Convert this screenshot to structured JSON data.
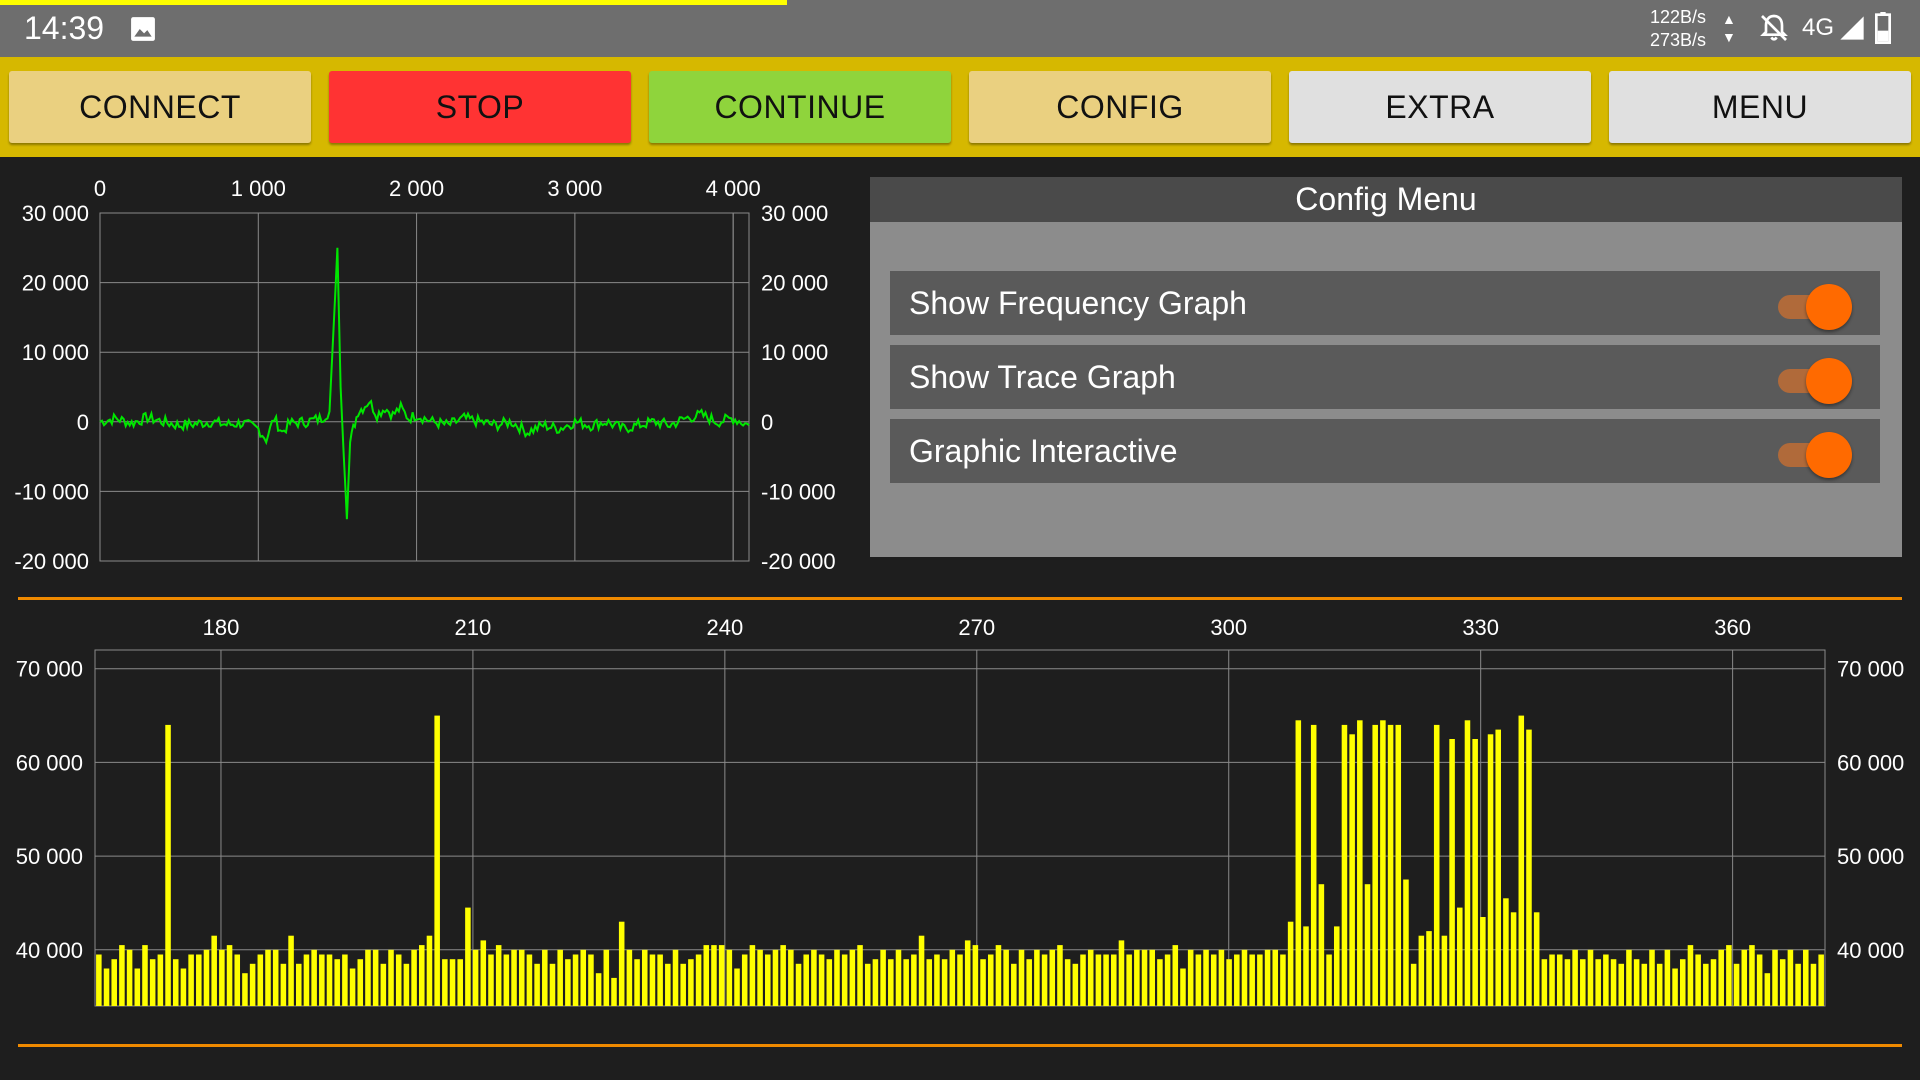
{
  "status_bar": {
    "time": "14:39",
    "net_up": "122B/s",
    "net_down": "273B/s",
    "net_type": "4G",
    "progress": 0.41,
    "icons": [
      "image-icon",
      "arrows-updown-icon",
      "bell-off-icon",
      "signal-icon",
      "battery-icon"
    ]
  },
  "toolbar": {
    "buttons": [
      {
        "label": "CONNECT",
        "color": "#ead080"
      },
      {
        "label": "STOP",
        "color": "#ff3333"
      },
      {
        "label": "CONTINUE",
        "color": "#8fd43c"
      },
      {
        "label": "CONFIG",
        "color": "#ead080"
      },
      {
        "label": "EXTRA",
        "color": "#e0e0e0"
      },
      {
        "label": "MENU",
        "color": "#e0e0e0"
      }
    ]
  },
  "config_menu": {
    "title": "Config Menu",
    "items": [
      {
        "label": "Show Frequency Graph",
        "on": true
      },
      {
        "label": "Show Trace Graph",
        "on": true
      },
      {
        "label": "Graphic Interactive",
        "on": true
      }
    ]
  },
  "colors": {
    "trace": "#00e600",
    "bars": "#ffff00",
    "separator": "#f08a00",
    "toolbar": "#d6b800"
  },
  "chart_data": [
    {
      "type": "line",
      "series": [
        {
          "color": "#00e600",
          "x": [
            0,
            100,
            200,
            300,
            400,
            500,
            600,
            700,
            800,
            900,
            1000,
            1050,
            1100,
            1150,
            1200,
            1300,
            1400,
            1450,
            1500,
            1520,
            1540,
            1560,
            1580,
            1600,
            1630,
            1660,
            1700,
            1750,
            1800,
            1850,
            1900,
            1950,
            2000,
            2100,
            2200,
            2300,
            2400,
            2500,
            2600,
            2700,
            2800,
            2900,
            3000,
            3100,
            3200,
            3300,
            3400,
            3500,
            3600,
            3700,
            3800,
            3900,
            4000,
            4100
          ],
          "y": [
            0,
            500,
            -200,
            600,
            0,
            -500,
            -300,
            0,
            -400,
            -200,
            -1000,
            -2500,
            500,
            -1500,
            -200,
            0,
            500,
            1500,
            25000,
            5000,
            -5000,
            -14000,
            -3000,
            -1000,
            1500,
            2000,
            3000,
            1000,
            2000,
            1000,
            2000,
            500,
            1000,
            0,
            -500,
            500,
            0,
            -500,
            0,
            -1500,
            -500,
            -1000,
            0,
            -500,
            0,
            -1000,
            -500,
            0,
            -500,
            500,
            1000,
            0,
            500,
            -500
          ]
        }
      ],
      "xlim": [
        0,
        4100
      ],
      "ylim": [
        -20000,
        30000
      ],
      "xticks": [
        "0",
        "1 000",
        "2 000",
        "3 000",
        "4 000"
      ],
      "yticks": [
        "30 000",
        "20 000",
        "10 000",
        "0",
        "-10 000",
        "-20 000"
      ],
      "grid": true
    },
    {
      "type": "bar",
      "color": "#ffff00",
      "xlim": [
        165,
        371
      ],
      "ylim": [
        34000,
        72000
      ],
      "xticks": [
        "180",
        "210",
        "240",
        "270",
        "300",
        "330",
        "360"
      ],
      "yticks": [
        "70 000",
        "60 000",
        "50 000",
        "40 000"
      ],
      "grid": true,
      "x_start": 165,
      "x_step": 1,
      "values": [
        39500,
        38000,
        39000,
        40500,
        40000,
        38000,
        40500,
        39000,
        39500,
        64000,
        39000,
        38000,
        39500,
        39500,
        40000,
        41500,
        40000,
        40500,
        39500,
        37500,
        38500,
        39500,
        40000,
        40000,
        38500,
        41500,
        38500,
        39500,
        40000,
        39500,
        39500,
        39000,
        39500,
        38000,
        39000,
        40000,
        40000,
        38500,
        40000,
        39500,
        38500,
        40000,
        40500,
        41500,
        65000,
        39000,
        39000,
        39000,
        44500,
        40000,
        41000,
        39500,
        40500,
        39500,
        40000,
        40000,
        39500,
        38500,
        40000,
        38500,
        40000,
        39000,
        39500,
        40000,
        39500,
        37500,
        40000,
        37000,
        43000,
        40000,
        39000,
        40000,
        39500,
        39500,
        38500,
        40000,
        38500,
        39000,
        39500,
        40500,
        40500,
        40500,
        40000,
        38000,
        39500,
        40500,
        40000,
        39500,
        40000,
        40500,
        40000,
        38500,
        39500,
        40000,
        39500,
        39000,
        40000,
        39500,
        40000,
        40500,
        38500,
        39000,
        40000,
        39000,
        40000,
        39000,
        39500,
        41500,
        39000,
        39500,
        39000,
        40000,
        39500,
        41000,
        40500,
        39000,
        39500,
        40500,
        40000,
        38500,
        40000,
        39000,
        40000,
        39500,
        40000,
        40500,
        39000,
        38500,
        39500,
        40000,
        39500,
        39500,
        39500,
        41000,
        39500,
        40000,
        40000,
        40000,
        39000,
        39500,
        40500,
        38000,
        40000,
        39500,
        40000,
        39500,
        40000,
        39000,
        39500,
        40000,
        39500,
        39500,
        40000,
        40000,
        39500,
        43000,
        64500,
        42500,
        64000,
        47000,
        39500,
        42500,
        64000,
        63000,
        64500,
        47000,
        64000,
        64500,
        64000,
        64000,
        47500,
        38500,
        41500,
        42000,
        64000,
        41500,
        62500,
        44500,
        64500,
        62500,
        43500,
        63000,
        63500,
        45500,
        44000,
        65000,
        63500,
        44000,
        39000,
        39500,
        39500,
        39000,
        40000,
        39000,
        40000,
        39000,
        39500,
        39000,
        38500,
        40000,
        39000,
        38500,
        40000,
        38500,
        40000,
        38000,
        39000,
        40500,
        39500,
        38500,
        39000,
        40000,
        40500,
        38500,
        40000,
        40500,
        39500,
        37500,
        40000,
        39000,
        40000,
        38500,
        40000,
        38500,
        39500
      ]
    }
  ]
}
